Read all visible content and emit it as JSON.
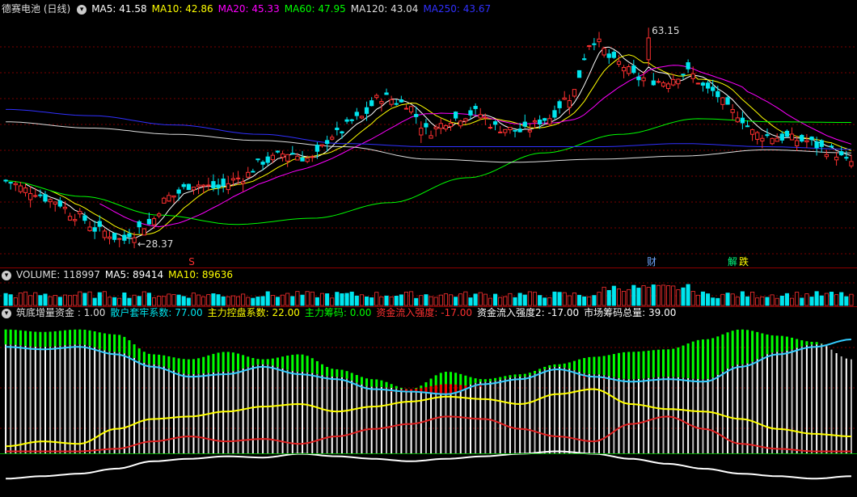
{
  "colors": {
    "ma5": "#ffffff",
    "ma10": "#ffff00",
    "ma20": "#ff00ff",
    "ma60": "#00ff00",
    "ma120": "#dddddd",
    "ma250": "#3030ff",
    "up": "#ff3030",
    "down": "#00e5ee",
    "grid": "#7a0000",
    "green_bar": "#00ff00",
    "red_bar": "#ff0000"
  },
  "price_panel": {
    "stock_name": "德赛电池 (日线)",
    "indicators": [
      {
        "label": "MA5: 41.58",
        "color": "#ffffff"
      },
      {
        "label": "MA10: 42.86",
        "color": "#ffff00"
      },
      {
        "label": "MA20: 45.33",
        "color": "#ff00ff"
      },
      {
        "label": "MA60: 47.95",
        "color": "#00ff00"
      },
      {
        "label": "MA120: 43.04",
        "color": "#dddddd"
      },
      {
        "label": "MA250: 43.67",
        "color": "#3030ff"
      }
    ],
    "high_label": "63.15",
    "low_label": "28.37",
    "markers": [
      {
        "text": "S",
        "color": "#ff3030"
      },
      {
        "text": "财",
        "color": "#6fa8ff"
      },
      {
        "text": "解",
        "color": "#00ff80"
      },
      {
        "text": "跌",
        "color": "#ffff00"
      }
    ]
  },
  "volume_panel": {
    "indicators": [
      {
        "label": "VOLUME: 118997",
        "color": "#dddddd"
      },
      {
        "label": "MA5: 89414",
        "color": "#ffffff"
      },
      {
        "label": "MA10: 89636",
        "color": "#ffff00"
      }
    ]
  },
  "indicator_panel": {
    "indicators": [
      {
        "label": "筑底增量资金 : 1.00",
        "color": "#dddddd"
      },
      {
        "label": "散户套牢系数: 77.00",
        "color": "#00e5ee"
      },
      {
        "label": "主力控盘系数: 22.00",
        "color": "#ffff00"
      },
      {
        "label": "主力筹码: 0.00",
        "color": "#00ff00"
      },
      {
        "label": "资金流入强度: -17.00",
        "color": "#ff3030"
      },
      {
        "label": "资金流入强度2: -17.00",
        "color": "#ffffff"
      },
      {
        "label": "市场筹码总量: 39.00",
        "color": "#ffffff"
      }
    ]
  },
  "chart_data": {
    "type": "candlestick",
    "price_range": [
      26,
      65
    ],
    "ohlc": [],
    "ma_lines": [],
    "volume": [],
    "indicator_series": []
  }
}
